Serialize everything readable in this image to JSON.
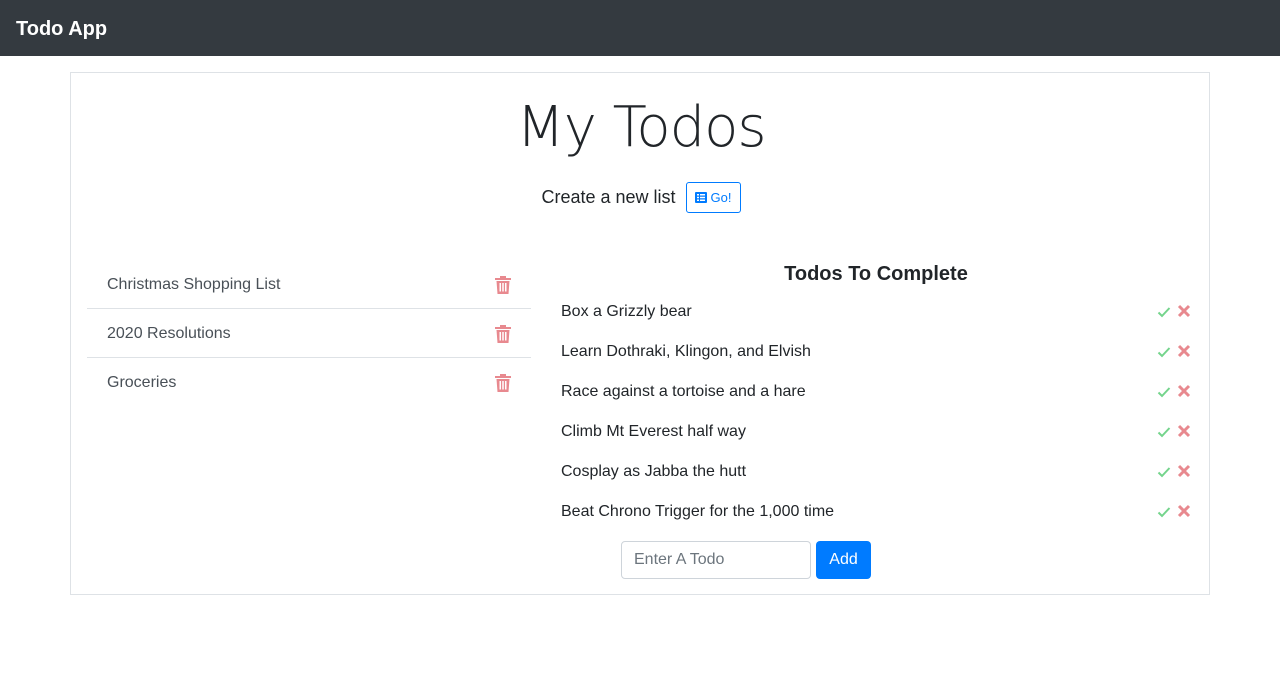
{
  "navbar": {
    "brand": "Todo App"
  },
  "main": {
    "title": "My Todos",
    "new_list": {
      "label": "Create a new list",
      "button_label": "Go!",
      "button_icon": "list-icon"
    }
  },
  "lists": {
    "items": [
      {
        "name": "Christmas Shopping List",
        "icon": "trash-icon"
      },
      {
        "name": "2020 Resolutions",
        "icon": "trash-icon"
      },
      {
        "name": "Groceries",
        "icon": "trash-icon"
      }
    ]
  },
  "todos": {
    "title": "Todos To Complete",
    "items": [
      {
        "text": "Box a Grizzly bear"
      },
      {
        "text": "Learn Dothraki, Klingon, and Elvish"
      },
      {
        "text": "Race against a tortoise and a hare"
      },
      {
        "text": "Climb Mt Everest half way"
      },
      {
        "text": "Cosplay as Jabba the hutt"
      },
      {
        "text": "Beat Chrono Trigger for the 1,000 time"
      }
    ],
    "input": {
      "placeholder": "Enter A Todo",
      "value": ""
    },
    "add_label": "Add"
  },
  "colors": {
    "navbar": "#343a40",
    "primary": "#007bff",
    "trash": "#e8898f",
    "check": "#74d48c",
    "delete": "#e8898f"
  }
}
